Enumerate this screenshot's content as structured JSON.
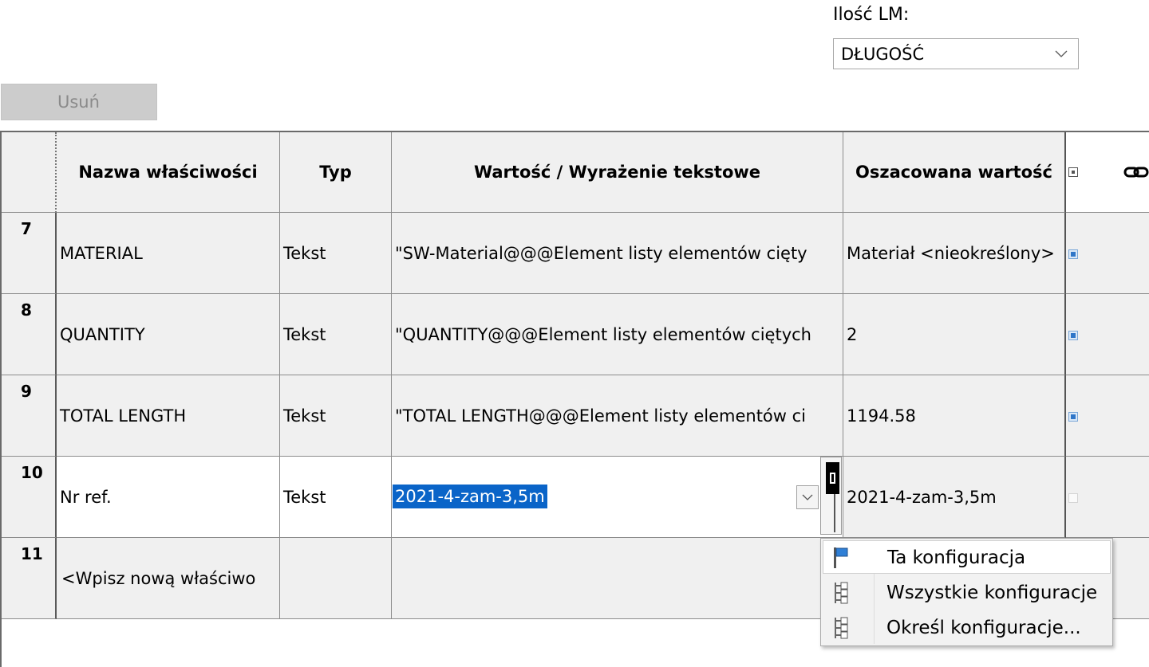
{
  "top": {
    "lm_label": "Ilość LM:",
    "lm_select_value": "DŁUGOŚĆ",
    "delete_button": "Usuń"
  },
  "table": {
    "headers": {
      "name": "Nazwa właściwości",
      "type": "Typ",
      "value": "Wartość / Wyrażenie tekstowe",
      "evaluated": "Oszacowana wartość"
    },
    "rows": [
      {
        "num": "7",
        "name": "MATERIAL",
        "type": "Tekst",
        "value": "\"SW-Material@@@Element listy elementów cięty",
        "evaluated": "Materiał <nieokreślony>",
        "checked": true
      },
      {
        "num": "8",
        "name": "QUANTITY",
        "type": "Tekst",
        "value": "\"QUANTITY@@@Element listy elementów ciętych",
        "evaluated": "2",
        "checked": true
      },
      {
        "num": "9",
        "name": "TOTAL LENGTH",
        "type": "Tekst",
        "value": "\"TOTAL LENGTH@@@Element listy elementów ci",
        "evaluated": "1194.58",
        "checked": true
      },
      {
        "num": "10",
        "name": "Nr ref.",
        "type": "Tekst",
        "value": "2021-4-zam-3,5m",
        "evaluated": "2021-4-zam-3,5m",
        "checked": false
      },
      {
        "num": "11",
        "name": "<Wpisz nową właściwo",
        "type": "",
        "value": "",
        "evaluated": "",
        "checked": false
      }
    ]
  },
  "config_menu": {
    "items": [
      {
        "label": "Ta konfiguracja",
        "icon": "flag-config-icon"
      },
      {
        "label": "Wszystkie konfiguracje",
        "icon": "tree-config-icon"
      },
      {
        "label": "Określ konfiguracje...",
        "icon": "tree-config-icon"
      }
    ]
  },
  "colors": {
    "selection": "#0a64c8",
    "checkbox": "#2f76c8",
    "header_bg": "#f0f0f0"
  }
}
